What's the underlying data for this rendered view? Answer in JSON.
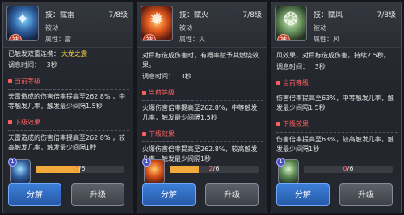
{
  "cards": [
    {
      "icon": "lightning-spirit-icon",
      "badge_label": "被动",
      "name_prefix": "技：",
      "name": "赋雷",
      "level": "7/8级",
      "passive_label": "被动",
      "attr_label": "属性：",
      "attr_value": "雷",
      "condition_prefix": "已触发双重连携：",
      "condition_link": "大龙之震",
      "cooldown_label": "调息时间：",
      "cooldown_value": "3秒",
      "current_header": "当前等级",
      "current_text": "天雷造成的伤害倍率提高至262.8% ，中等触发几率，触发最少间隔1.5秒",
      "next_header": "下级效果",
      "next_text": "天雷造成的伤害倍率提高至262.8% ，较高触发几率，触发最少间隔1秒",
      "gem_badge": "1",
      "progress_current": "3",
      "progress_total": "/6",
      "progress_fraction": 0.5,
      "btn_split": "分解",
      "btn_upgrade": "升级"
    },
    {
      "icon": "fire-spirit-icon",
      "badge_label": "被动",
      "name_prefix": "技：",
      "name": "赋火",
      "level": "7/8级",
      "passive_label": "被动",
      "attr_label": "属性：",
      "attr_value": "火",
      "condition_prefix": "对目标造成伤害时，有概率赋予其燃烧效果。",
      "condition_link": "",
      "cooldown_label": "调息时间：",
      "cooldown_value": "3秒",
      "current_header": "当前等级",
      "current_text": "火爆伤害倍率提高至262.8%，中等触发几率，触发最少间隔1.5秒",
      "next_header": "下级效果",
      "next_text": "火爆伤害倍率提高至262.8%，较高触发几率，触发最少间隔1秒",
      "gem_badge": "1",
      "progress_current": "2",
      "progress_total": "/6",
      "progress_fraction": 0.33,
      "btn_split": "分解",
      "btn_upgrade": "升级"
    },
    {
      "icon": "wind-spirit-icon",
      "badge_label": "被动",
      "name_prefix": "技：",
      "name": "赋风",
      "level": "7/8级",
      "passive_label": "被动",
      "attr_label": "属性：",
      "attr_value": "风",
      "condition_prefix": "风效果，对目标造成伤害，持续2.5秒。",
      "condition_link": "",
      "cooldown_label": "调息时间：",
      "cooldown_value": "3秒",
      "current_header": "当前等级",
      "current_text": "伤害倍率提高至63%，中等触发几率，触发最少间隔1.5秒",
      "next_header": "下级效果",
      "next_text": "伤害倍率提高至63%，较高触发几率，触发最少间隔1秒",
      "gem_badge": "1",
      "progress_current": "0",
      "progress_total": "/6",
      "progress_fraction": 0,
      "btn_split": "分解",
      "btn_upgrade": "升级"
    }
  ]
}
